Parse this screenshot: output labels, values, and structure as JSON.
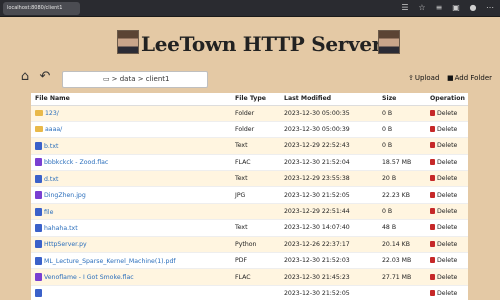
{
  "browser": {
    "url": "localhost:8080/client1",
    "icons": [
      "extensions-icon",
      "star-icon",
      "reading-list-icon",
      "collections-icon",
      "profile-icon",
      "menu-icon"
    ]
  },
  "header": {
    "title": "LeeTown HTTP Server"
  },
  "toolbar": {
    "breadcrumb": "> data > client1",
    "upload_label": "Upload",
    "add_folder_label": "Add Folder"
  },
  "table": {
    "columns": [
      "File Name",
      "File Type",
      "Last Modified",
      "Size",
      "Operation"
    ],
    "delete_label": "Delete",
    "rows": [
      {
        "name": "123/",
        "type": "Folder",
        "modified": "2023-12-30 05:00:35",
        "size": "0 B",
        "icon": "folder"
      },
      {
        "name": "aaaa/",
        "type": "Folder",
        "modified": "2023-12-30 05:00:39",
        "size": "0 B",
        "icon": "folder"
      },
      {
        "name": "b.txt",
        "type": "Text",
        "modified": "2023-12-29 22:52:43",
        "size": "0 B",
        "icon": "text"
      },
      {
        "name": "bbbkckck - Zood.flac",
        "type": "FLAC",
        "modified": "2023-12-30 21:52:04",
        "size": "18.57 MB",
        "icon": "audio"
      },
      {
        "name": "d.txt",
        "type": "Text",
        "modified": "2023-12-29 23:55:38",
        "size": "20 B",
        "icon": "text"
      },
      {
        "name": "DingZhen.jpg",
        "type": "JPG",
        "modified": "2023-12-30 21:52:05",
        "size": "22.23 KB",
        "icon": "image"
      },
      {
        "name": "file",
        "type": "",
        "modified": "2023-12-29 22:51:44",
        "size": "0 B",
        "icon": "text"
      },
      {
        "name": "hahaha.txt",
        "type": "Text",
        "modified": "2023-12-30 14:07:40",
        "size": "48 B",
        "icon": "text"
      },
      {
        "name": "HttpServer.py",
        "type": "Python",
        "modified": "2023-12-26 22:37:17",
        "size": "20.14 KB",
        "icon": "code"
      },
      {
        "name": "ML_Lecture_Sparse_Kernel_Machine(1).pdf",
        "type": "PDF",
        "modified": "2023-12-30 21:52:03",
        "size": "22.03 MB",
        "icon": "pdf"
      },
      {
        "name": "Venoflame - I Got Smoke.flac",
        "type": "FLAC",
        "modified": "2023-12-30 21:45:23",
        "size": "27.71 MB",
        "icon": "audio"
      },
      {
        "name": "",
        "type": "",
        "modified": "2023-12-30 21:52:05",
        "size": "",
        "icon": "text"
      }
    ]
  }
}
